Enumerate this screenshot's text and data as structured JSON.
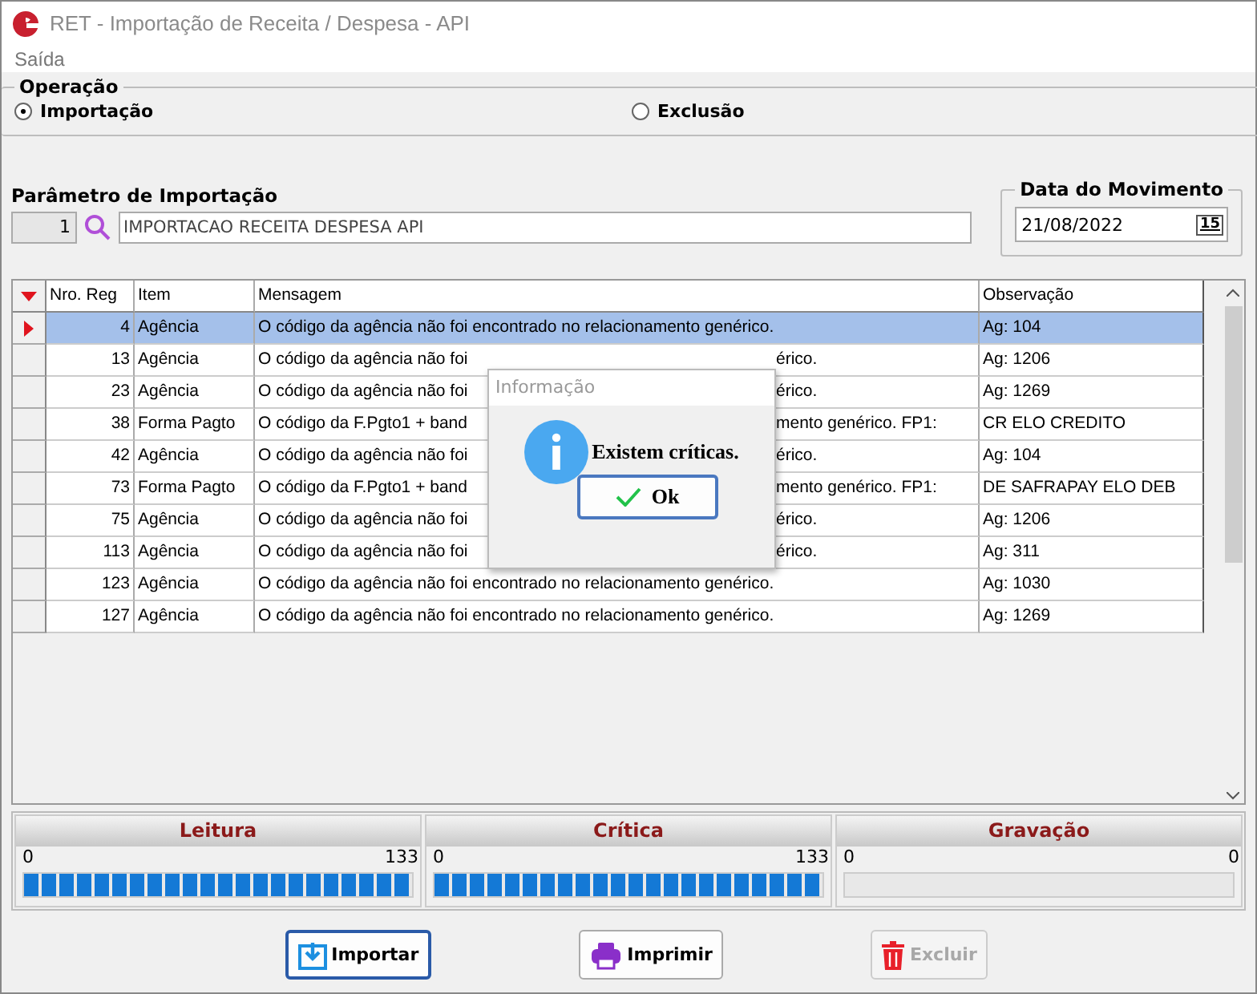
{
  "window": {
    "title": "RET - Importação de Receita / Despesa - API"
  },
  "menu": [
    {
      "label": "Saída"
    }
  ],
  "operation": {
    "title": "Operação",
    "options": [
      {
        "label": "Importação",
        "selected": true
      },
      {
        "label": "Exclusão",
        "selected": false
      }
    ]
  },
  "import_parameter": {
    "label": "Parâmetro de Importação",
    "code": "1",
    "description": "IMPORTACAO RECEITA DESPESA API"
  },
  "movement_date": {
    "title": "Data do Movimento",
    "value": "21/08/2022",
    "calendar_day": "15"
  },
  "table": {
    "columns": [
      "Nro. Reg",
      "Item",
      "Mensagem",
      "Observação"
    ],
    "rows": [
      {
        "nro": "4",
        "item": "Agência",
        "message": [
          "O código da agência não foi encontrado no relacionamento genérico."
        ],
        "observation": "Ag: 104",
        "selected": true
      },
      {
        "nro": "13",
        "item": "Agência",
        "message": [
          "O código da agência não foi",
          "érico."
        ],
        "observation": "Ag: 1206",
        "selected": false
      },
      {
        "nro": "23",
        "item": "Agência",
        "message": [
          "O código da agência não foi",
          "érico."
        ],
        "observation": "Ag: 1269",
        "selected": false
      },
      {
        "nro": "38",
        "item": "Forma Pagto",
        "message": [
          "O código da F.Pgto1 + band",
          "mento genérico. FP1:"
        ],
        "observation": "CR ELO CREDITO",
        "selected": false
      },
      {
        "nro": "42",
        "item": "Agência",
        "message": [
          "O código da agência não foi",
          "érico."
        ],
        "observation": "Ag: 104",
        "selected": false
      },
      {
        "nro": "73",
        "item": "Forma Pagto",
        "message": [
          "O código da F.Pgto1 + band",
          "mento genérico. FP1:"
        ],
        "observation": "DE SAFRAPAY ELO DEB",
        "selected": false
      },
      {
        "nro": "75",
        "item": "Agência",
        "message": [
          "O código da agência não foi",
          "érico."
        ],
        "observation": "Ag: 1206",
        "selected": false
      },
      {
        "nro": "113",
        "item": "Agência",
        "message": [
          "O código da agência não foi",
          "érico."
        ],
        "observation": "Ag: 311",
        "selected": false
      },
      {
        "nro": "123",
        "item": "Agência",
        "message": [
          "O código da agência não foi encontrado no relacionamento genérico."
        ],
        "observation": "Ag: 1030",
        "selected": false
      },
      {
        "nro": "127",
        "item": "Agência",
        "message": [
          "O código da agência não foi encontrado no relacionamento genérico."
        ],
        "observation": "Ag: 1269",
        "selected": false
      }
    ]
  },
  "progress": [
    {
      "title": "Leitura",
      "min": "0",
      "max": "133",
      "level": 1
    },
    {
      "title": "Crítica",
      "min": "0",
      "max": "133",
      "level": 1
    },
    {
      "title": "Gravação",
      "min": "0",
      "max": "0",
      "level": 0
    }
  ],
  "buttons": [
    {
      "kind": "import",
      "label": "Importar",
      "disabled": false,
      "focused": true
    },
    {
      "kind": "print",
      "label": "Imprimir",
      "disabled": false,
      "focused": false
    },
    {
      "kind": "delete",
      "label": "Excluir",
      "disabled": true,
      "focused": false
    }
  ],
  "dialog": {
    "title": "Informação",
    "message": "Existem críticas.",
    "button": "Ok"
  }
}
